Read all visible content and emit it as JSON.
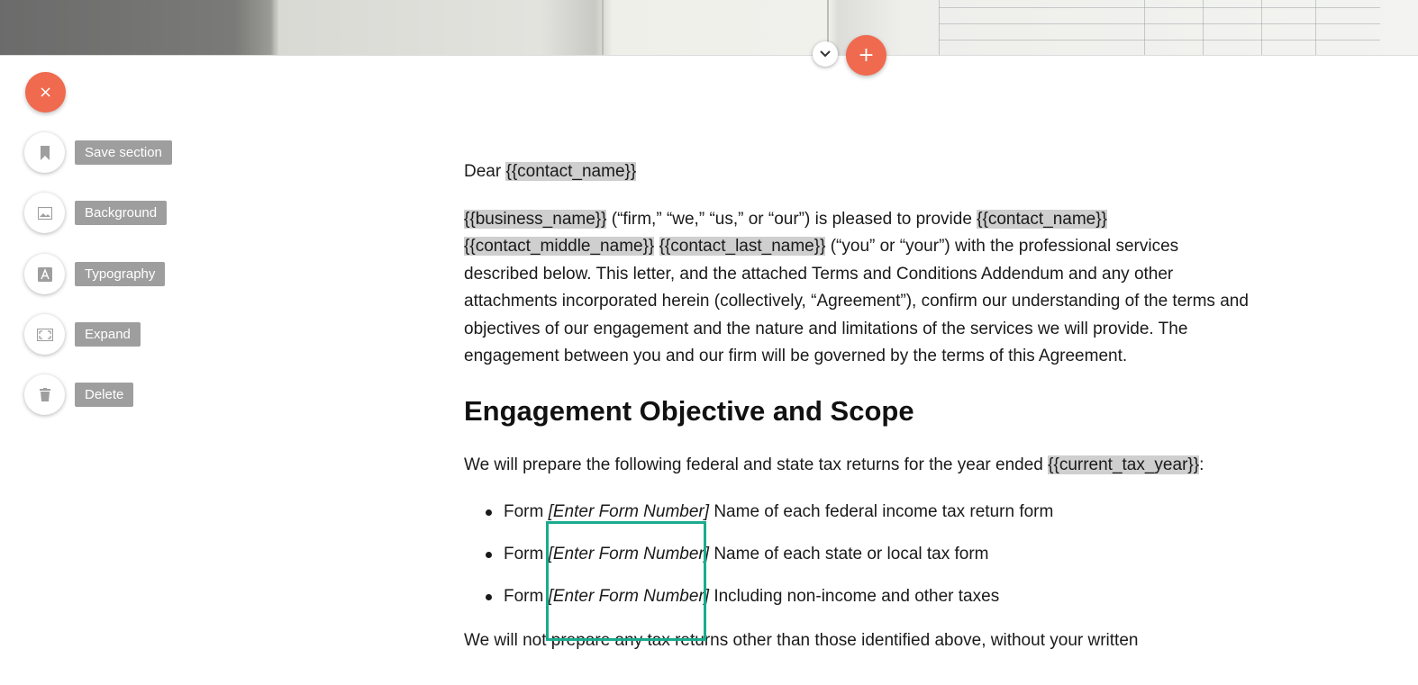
{
  "tools": {
    "close_icon": "close-icon",
    "items": [
      {
        "label": "Save section",
        "icon": "bookmark-icon"
      },
      {
        "label": "Background",
        "icon": "image-icon"
      },
      {
        "label": "Typography",
        "icon": "text-a-icon"
      },
      {
        "label": "Expand",
        "icon": "expand-icon"
      },
      {
        "label": "Delete",
        "icon": "trash-icon"
      }
    ]
  },
  "toolbar": {
    "plus_label": "+",
    "close_label": "×"
  },
  "doc": {
    "greeting": "Dear ",
    "contact_name": "{{contact_name}}",
    "para1": {
      "business_name": "{{business_name}}",
      "t1": " (“firm,” “we,” “us,” or “our”) is pleased to provide ",
      "contact_name": "{{contact_name}}",
      "contact_middle_name": "{{contact_middle_name}}",
      "contact_last_name": "{{contact_last_name}}",
      "t2": " (“you” or “your”) with the professional services described below. This letter, and the attached Terms and Conditions Addendum and any other attachments incorporated herein (collectively, “Agreement”), confirm our understanding of the terms and objectives of our engagement and the nature and limitations of the services we will provide. The engagement between you and our firm will be governed by the terms of this Agreement."
    },
    "heading": "Engagement Objective and Scope",
    "para2": {
      "text": "We will prepare the following federal and state tax returns for the year ended ",
      "tag": "{{current_tax_year}}",
      "end": ":"
    },
    "bullets": [
      {
        "prefix": "Form ",
        "placeholder": "[Enter Form Number]",
        "text": " Name of each federal income tax return form"
      },
      {
        "prefix": "Form ",
        "placeholder": "[Enter Form Number]",
        "text": " Name of each state or local tax form"
      },
      {
        "prefix": "Form ",
        "placeholder": "[Enter Form Number]",
        "text": " Including non-income and other taxes"
      }
    ],
    "para3": "We will not prepare any tax returns other than those identified above, without your written"
  },
  "colors": {
    "accent": "#ef6a4e",
    "highlight_border": "#1aab8e",
    "tag_bg": "#cfcfcf",
    "tool_label_bg": "#9e9e9e"
  }
}
